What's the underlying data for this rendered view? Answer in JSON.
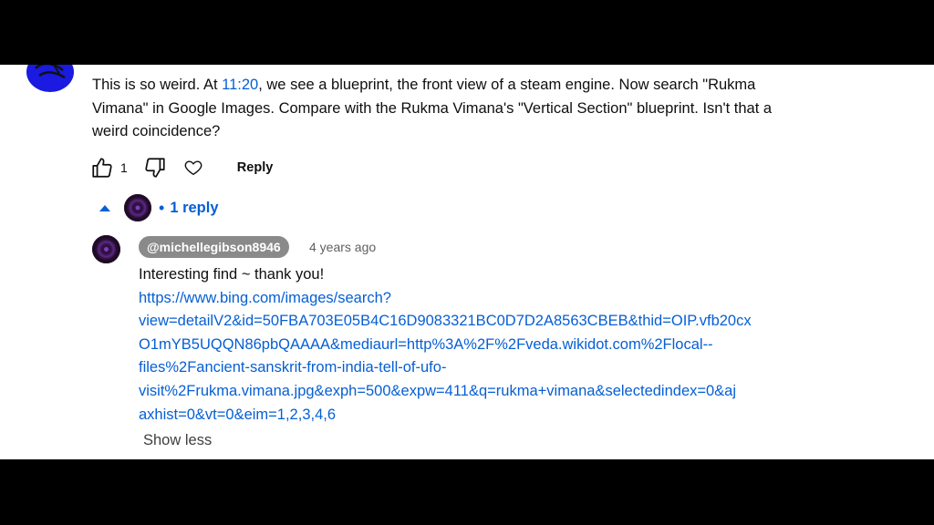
{
  "comment": {
    "text_before": "This is so weird. At ",
    "timestamp": "11:20",
    "text_after": ", we see a blueprint, the front view of a steam engine. Now search \"Rukma Vimana\" in Google Images. Compare with the Rukma Vimana's \"Vertical Section\" blueprint. Isn't that a weird coincidence?",
    "like_count": "1",
    "reply_label": "Reply"
  },
  "replies": {
    "separator": "•",
    "count_label": "1 reply"
  },
  "reply": {
    "author": "@michellegibson8946",
    "time": "4 years ago",
    "text": "Interesting find ~ thank you!",
    "url_lines": [
      "https://www.bing.com/images/search?",
      "view=detailV2&id=50FBA703E05B4C16D9083321BC0D7D2A8563CBEB&thid=OIP.vfb20cx",
      "O1mYB5UQQN86pbQAAAA&mediaurl=http%3A%2F%2Fveda.wikidot.com%2Flocal--",
      "files%2Fancient-sanskrit-from-india-tell-of-ufo-",
      "visit%2Frukma.vimana.jpg&exph=500&expw=411&q=rukma+vimana&selectedindex=0&aj",
      "axhist=0&vt=0&eim=1,2,3,4,6"
    ],
    "show_less_label": "Show less"
  },
  "colors": {
    "link": "#065fd4",
    "chip_bg": "#8a8a8a",
    "avatar_main": "#1a1ae0"
  },
  "icons": [
    "thumbs-up-icon",
    "thumbs-down-icon",
    "heart-icon",
    "caret-up-icon"
  ]
}
